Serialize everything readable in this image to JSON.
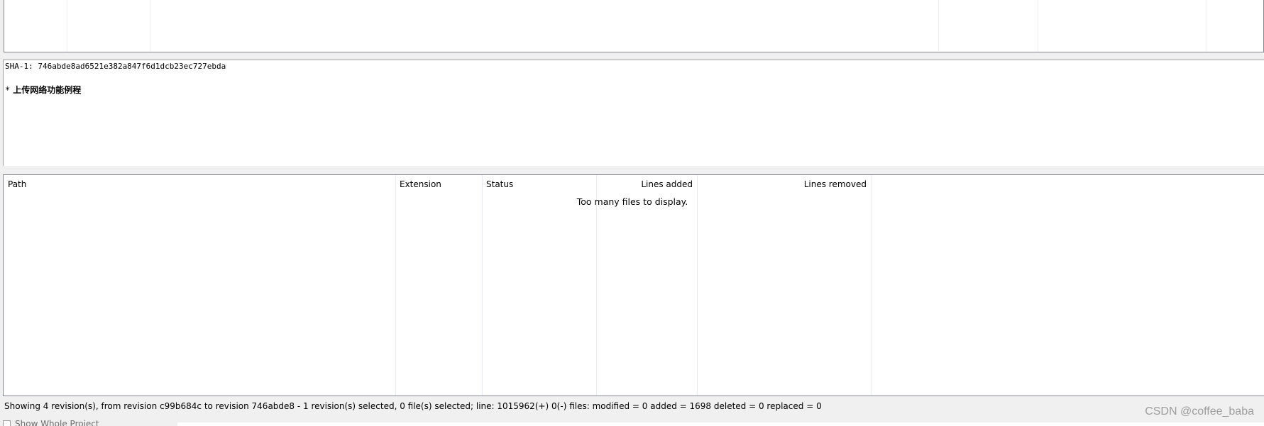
{
  "message_panel": {
    "sha_line": "SHA-1: 746abde8ad6521e382a847f6d1dcb23ec727ebda",
    "bullet": "*",
    "subject": "上传网络功能例程"
  },
  "file_list": {
    "columns": {
      "path": "Path",
      "extension": "Extension",
      "status": "Status",
      "lines_added": "Lines added",
      "lines_removed": "Lines removed"
    },
    "empty_message": "Too many files to display."
  },
  "status_bar": {
    "text": "Showing 4 revision(s), from revision c99b684c to revision 746abde8 - 1 revision(s) selected, 0 file(s) selected; line: 1015962(+) 0(-) files: modified = 0 added = 1698 deleted = 0 replaced = 0"
  },
  "options": {
    "show_whole_project_label": "Show Whole Project",
    "show_whole_project_checked": false
  },
  "watermark": "CSDN @coffee_baba"
}
